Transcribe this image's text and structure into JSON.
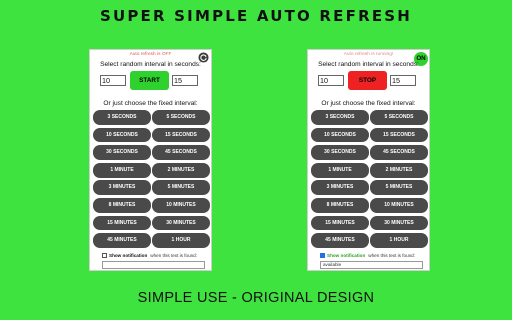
{
  "headline": "SUPER SIMPLE AUTO REFRESH",
  "footer": "SIMPLE USE - ORIGINAL DESIGN",
  "left_panel": {
    "status": "Auto refresh is OFF",
    "random_title": "Select random interval in seconds:",
    "min_value": "10",
    "max_value": "15",
    "action_label": "START",
    "fixed_title": "Or just choose the fixed interval:",
    "notify_label": "Show notification",
    "notify_text": "when this text is found:",
    "notify_checked": false,
    "found_text": ""
  },
  "right_panel": {
    "status": "Auto refresh is running!",
    "on_label": "ON",
    "random_title": "Select random interval in seconds:",
    "min_value": "10",
    "max_value": "15",
    "action_label": "STOP",
    "fixed_title": "Or just choose the fixed interval:",
    "notify_label": "Show notification",
    "notify_text": "when this text is found:",
    "notify_checked": true,
    "found_text": "available"
  },
  "intervals": [
    "3 SECONDS",
    "5 SECONDS",
    "10 SECONDS",
    "15 SECONDS",
    "30 SECONDS",
    "45 SECONDS",
    "1 MINUTE",
    "2 MINUTES",
    "3 MINUTES",
    "5 MINUTES",
    "8 MINUTES",
    "10 MINUTES",
    "15 MINUTES",
    "30 MINUTES",
    "45 MINUTES",
    "1 HOUR"
  ],
  "colors": {
    "background": "#3fe33f",
    "start": "#2ed12e",
    "stop": "#ee2222",
    "interval_button": "#4a4a4a",
    "on_badge": "#2ed12e"
  },
  "icons": {
    "left_corner": "reload-icon",
    "right_corner": "on-badge"
  }
}
